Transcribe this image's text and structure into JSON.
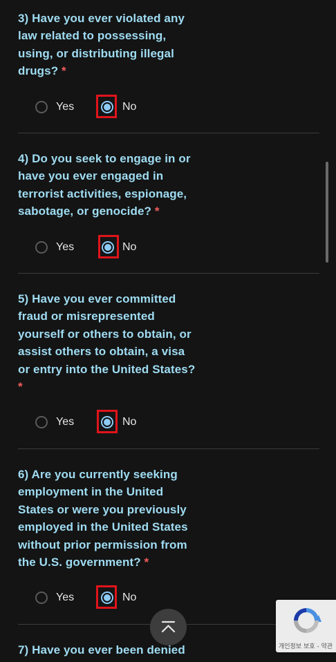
{
  "questions": [
    {
      "lines": [
        "3) Have you ever violated any",
        "law related to possessing,",
        "using, or distributing illegal",
        "drugs?"
      ],
      "required_mark": "*",
      "yes_label": "Yes",
      "no_label": "No",
      "selected": "No"
    },
    {
      "lines": [
        "4) Do you seek to engage in or",
        "have you ever engaged in",
        "terrorist activities, espionage,",
        "sabotage, or genocide?"
      ],
      "required_mark": "*",
      "yes_label": "Yes",
      "no_label": "No",
      "selected": "No"
    },
    {
      "lines": [
        "5) Have you ever committed",
        "fraud or misrepresented",
        "yourself or others to obtain, or",
        "assist others to obtain, a visa",
        "or entry into the United States?",
        ""
      ],
      "required_mark": "*",
      "yes_label": "Yes",
      "no_label": "No",
      "selected": "No"
    },
    {
      "lines": [
        "6) Are you currently seeking",
        "employment in the United",
        "States or were you previously",
        "employed in the United States",
        "without prior permission from",
        "the U.S. government?"
      ],
      "required_mark": "*",
      "yes_label": "Yes",
      "no_label": "No",
      "selected": "No"
    },
    {
      "lines": [
        "7) Have you ever been denied"
      ],
      "required_mark": ""
    }
  ],
  "recaptcha": {
    "footer_text": "개인정보 보호 - 약관"
  },
  "colors": {
    "question_text": "#9fdcf2",
    "required": "#f25c5c",
    "radio_selected": "#8ccbf5",
    "highlight": "#e0141b",
    "background": "#141414"
  },
  "icons": {
    "scroll_top": "chevron-up-icon",
    "recaptcha": "recaptcha-logo-icon"
  }
}
